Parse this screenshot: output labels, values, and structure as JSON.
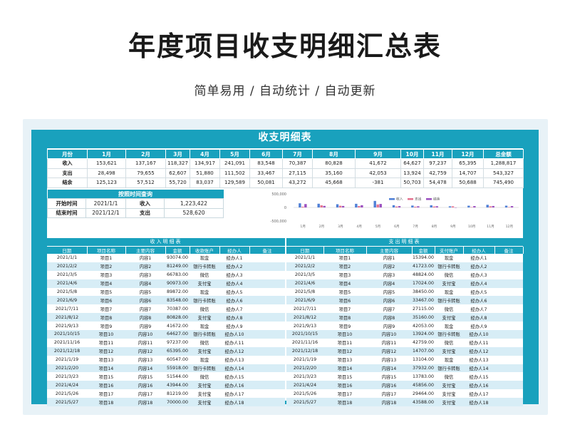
{
  "page": {
    "title": "年度项目收支明细汇总表",
    "subtitle": "简单易用 / 自动统计 / 自动更新"
  },
  "sheet": {
    "title": "收支明细表"
  },
  "summary": {
    "header": [
      "月份",
      "1月",
      "2月",
      "3月",
      "4月",
      "5月",
      "6月",
      "7月",
      "8月",
      "9月",
      "10月",
      "11月",
      "12月",
      "总金额"
    ],
    "rows": [
      [
        "收入",
        "153,621",
        "137,167",
        "118,327",
        "134,917",
        "241,091",
        "83,548",
        "70,387",
        "80,828",
        "41,672",
        "64,627",
        "97,237",
        "65,395",
        "1,288,817"
      ],
      [
        "支出",
        "28,498",
        "79,655",
        "62,607",
        "51,880",
        "111,502",
        "33,467",
        "27,115",
        "35,160",
        "42,053",
        "13,924",
        "42,759",
        "14,707",
        "543,327"
      ],
      [
        "结余",
        "125,123",
        "57,512",
        "55,720",
        "83,037",
        "129,589",
        "50,081",
        "43,272",
        "45,668",
        "-381",
        "50,703",
        "54,478",
        "50,688",
        "745,490"
      ]
    ]
  },
  "query": {
    "title": "按照时间查询",
    "start_label": "开始时间",
    "start_value": "2021/1/1",
    "end_label": "结束时间",
    "end_value": "2021/12/1",
    "income_label": "收入",
    "income_value": "1,223,422",
    "expense_label": "支出",
    "expense_value": "528,620"
  },
  "chart_data": {
    "type": "bar",
    "categories": [
      "1月",
      "2月",
      "3月",
      "4月",
      "5月",
      "6月",
      "7月",
      "8月",
      "9月",
      "10月",
      "11月",
      "12月"
    ],
    "series": [
      {
        "name": "收入",
        "values": [
          153621,
          137167,
          118327,
          134917,
          241091,
          83548,
          70387,
          80828,
          41672,
          64627,
          97237,
          65395
        ],
        "color": "#4f7fd6"
      },
      {
        "name": "支出",
        "values": [
          28498,
          79655,
          62607,
          51880,
          111502,
          33467,
          27115,
          35160,
          42053,
          13924,
          42759,
          14707
        ],
        "color": "#e4728f"
      },
      {
        "name": "结余",
        "values": [
          125123,
          57512,
          55720,
          83037,
          129589,
          50081,
          43272,
          45668,
          -381,
          50703,
          54478,
          50688
        ],
        "color": "#9a4fbf"
      }
    ],
    "ylim": [
      -500000,
      500000
    ],
    "yticks": [
      "500,000",
      "0",
      "-500,000"
    ],
    "legend": "top-center"
  },
  "income_section": {
    "title": "收入明细表",
    "columns": [
      "日期",
      "项目名称",
      "主要内容",
      "金额",
      "收款账户",
      "经办人",
      "备注"
    ],
    "rows": [
      [
        "2021/1/1",
        "项目1",
        "内容1",
        "93074.00",
        "现金",
        "经办人1",
        ""
      ],
      [
        "2021/2/2",
        "项目2",
        "内容2",
        "81249.00",
        "银行卡转账",
        "经办人2",
        ""
      ],
      [
        "2021/3/5",
        "项目3",
        "内容3",
        "66783.00",
        "微信",
        "经办人3",
        ""
      ],
      [
        "2021/4/6",
        "项目4",
        "内容4",
        "90973.00",
        "支付宝",
        "经办人4",
        ""
      ],
      [
        "2021/5/8",
        "项目5",
        "内容5",
        "89872.00",
        "现金",
        "经办人5",
        ""
      ],
      [
        "2021/6/9",
        "项目6",
        "内容6",
        "83548.00",
        "银行卡转账",
        "经办人6",
        ""
      ],
      [
        "2021/7/11",
        "项目7",
        "内容7",
        "70387.00",
        "微信",
        "经办人7",
        ""
      ],
      [
        "2021/8/12",
        "项目8",
        "内容8",
        "80828.00",
        "支付宝",
        "经办人8",
        ""
      ],
      [
        "2021/9/13",
        "项目9",
        "内容9",
        "41672.00",
        "现金",
        "经办人9",
        ""
      ],
      [
        "2021/10/15",
        "项目10",
        "内容10",
        "64627.00",
        "银行卡转账",
        "经办人10",
        ""
      ],
      [
        "2021/11/16",
        "项目11",
        "内容11",
        "97237.00",
        "微信",
        "经办人11",
        ""
      ],
      [
        "2021/12/18",
        "项目12",
        "内容12",
        "65395.00",
        "支付宝",
        "经办人12",
        ""
      ],
      [
        "2021/1/19",
        "项目13",
        "内容13",
        "60547.00",
        "现金",
        "经办人13",
        ""
      ],
      [
        "2021/2/20",
        "项目14",
        "内容14",
        "55918.00",
        "银行卡转账",
        "经办人14",
        ""
      ],
      [
        "2021/3/23",
        "项目15",
        "内容15",
        "51544.00",
        "微信",
        "经办人15",
        ""
      ],
      [
        "2021/4/24",
        "项目16",
        "内容16",
        "43944.00",
        "支付宝",
        "经办人16",
        ""
      ],
      [
        "2021/5/26",
        "项目17",
        "内容17",
        "81219.00",
        "支付宝",
        "经办人17",
        ""
      ],
      [
        "2021/5/27",
        "项目18",
        "内容18",
        "70000.00",
        "支付宝",
        "经办人18",
        ""
      ]
    ]
  },
  "expense_section": {
    "title": "支出明细表",
    "columns": [
      "日期",
      "项目名称",
      "主要内容",
      "金额",
      "支付账户",
      "经办人",
      "备注"
    ],
    "rows": [
      [
        "2021/1/1",
        "项目1",
        "内容1",
        "15394.00",
        "现金",
        "经办人1",
        ""
      ],
      [
        "2021/2/2",
        "项目2",
        "内容2",
        "41723.00",
        "银行卡转账",
        "经办人2",
        ""
      ],
      [
        "2021/3/5",
        "项目3",
        "内容3",
        "48824.00",
        "微信",
        "经办人3",
        ""
      ],
      [
        "2021/4/6",
        "项目4",
        "内容4",
        "17024.00",
        "支付宝",
        "经办人4",
        ""
      ],
      [
        "2021/5/8",
        "项目5",
        "内容5",
        "38450.00",
        "现金",
        "经办人5",
        ""
      ],
      [
        "2021/6/9",
        "项目6",
        "内容6",
        "33467.00",
        "银行卡转账",
        "经办人6",
        ""
      ],
      [
        "2021/7/11",
        "项目7",
        "内容7",
        "27115.00",
        "微信",
        "经办人7",
        ""
      ],
      [
        "2021/8/12",
        "项目8",
        "内容8",
        "35160.00",
        "支付宝",
        "经办人8",
        ""
      ],
      [
        "2021/9/13",
        "项目9",
        "内容9",
        "42053.00",
        "现金",
        "经办人9",
        ""
      ],
      [
        "2021/10/15",
        "项目10",
        "内容10",
        "13924.00",
        "银行卡转账",
        "经办人10",
        ""
      ],
      [
        "2021/11/16",
        "项目11",
        "内容11",
        "42759.00",
        "微信",
        "经办人11",
        ""
      ],
      [
        "2021/12/18",
        "项目12",
        "内容12",
        "14707.00",
        "支付宝",
        "经办人12",
        ""
      ],
      [
        "2021/1/19",
        "项目13",
        "内容13",
        "13104.00",
        "现金",
        "经办人13",
        ""
      ],
      [
        "2021/2/20",
        "项目14",
        "内容14",
        "37932.00",
        "银行卡转账",
        "经办人14",
        ""
      ],
      [
        "2021/3/23",
        "项目15",
        "内容15",
        "13783.00",
        "微信",
        "经办人15",
        ""
      ],
      [
        "2021/4/24",
        "项目16",
        "内容16",
        "45856.00",
        "支付宝",
        "经办人16",
        ""
      ],
      [
        "2021/5/26",
        "项目17",
        "内容17",
        "29464.00",
        "支付宝",
        "经办人17",
        ""
      ],
      [
        "2021/5/27",
        "项目18",
        "内容18",
        "43588.00",
        "支付宝",
        "经办人18",
        ""
      ]
    ]
  }
}
